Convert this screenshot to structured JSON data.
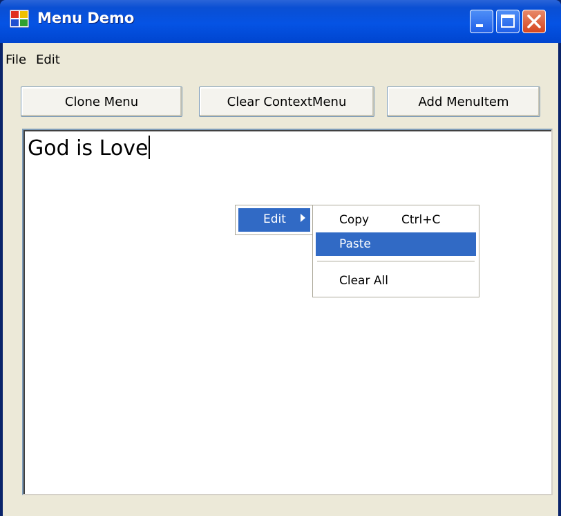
{
  "window": {
    "title": "Menu Demo"
  },
  "menubar": {
    "items": [
      "File",
      "Edit"
    ]
  },
  "buttons": {
    "clone": "Clone Menu",
    "clear": "Clear ContextMenu",
    "add": "Add MenuItem"
  },
  "textbox": {
    "value": "God is Love"
  },
  "context_menu": {
    "item": "Edit",
    "submenu": [
      {
        "label": "Copy",
        "shortcut": "Ctrl+C"
      },
      {
        "label": "Paste",
        "shortcut": ""
      },
      {
        "label": "Clear All",
        "shortcut": ""
      }
    ]
  },
  "colors": {
    "highlight": "#316ac5",
    "titlebar": "#0553e4",
    "face": "#ece9d8"
  }
}
